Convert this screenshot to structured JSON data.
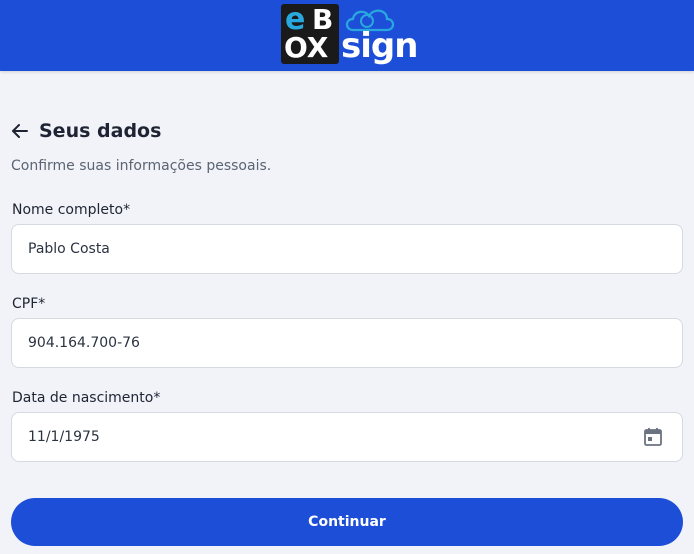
{
  "brand": {
    "logo_text_e": "e",
    "logo_text_b": "B",
    "logo_text_ox": "OX",
    "logo_text_sign": "sign",
    "header_color": "#1d4ed8",
    "accent_color": "#29a8e0"
  },
  "page": {
    "back_icon": "arrow-left-icon",
    "title": "Seus dados",
    "subtitle": "Confirme suas informações pessoais."
  },
  "form": {
    "full_name": {
      "label": "Nome completo*",
      "value": "Pablo Costa"
    },
    "cpf": {
      "label": "CPF*",
      "value": "904.164.700-76"
    },
    "birth_date": {
      "label": "Data de nascimento*",
      "value": "11/1/1975",
      "icon": "calendar-icon"
    }
  },
  "actions": {
    "continue_label": "Continuar",
    "button_color": "#1d4ed8"
  }
}
